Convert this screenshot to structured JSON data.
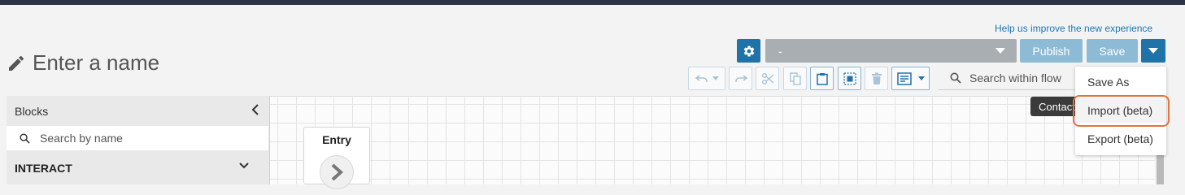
{
  "header": {
    "help_link": "Help us improve the new experience",
    "flow_name_placeholder": "Enter a name"
  },
  "toolbar": {
    "version_value": "-",
    "publish_label": "Publish",
    "save_label": "Save"
  },
  "flow_search": {
    "placeholder": "Search within flow"
  },
  "tooltip": {
    "text": "Contact"
  },
  "save_menu": {
    "items": [
      {
        "label": "Save As"
      },
      {
        "label": "Import (beta)",
        "highlighted": true
      },
      {
        "label": "Export (beta)"
      }
    ]
  },
  "sidebar": {
    "title": "Blocks",
    "search_placeholder": "Search by name",
    "sections": [
      {
        "label": "INTERACT",
        "expanded": false
      }
    ]
  },
  "canvas": {
    "nodes": [
      {
        "title": "Entry"
      }
    ]
  },
  "icons": {
    "edit": "pencil-icon",
    "settings": "gear-icon",
    "undo": "undo-icon",
    "redo": "redo-icon",
    "cut": "scissors-icon",
    "copy": "copy-icon",
    "paste": "clipboard-icon",
    "select": "select-all-icon",
    "delete": "trash-icon",
    "notes": "notes-icon",
    "search": "search-icon",
    "collapse": "chevron-left-icon"
  },
  "colors": {
    "primary": "#1f73a8",
    "primary_disabled": "#8dbad5",
    "select_bg": "#a9aeb3",
    "link": "#1b77b8",
    "highlight": "#e8723b",
    "topbar": "#2b3545"
  }
}
